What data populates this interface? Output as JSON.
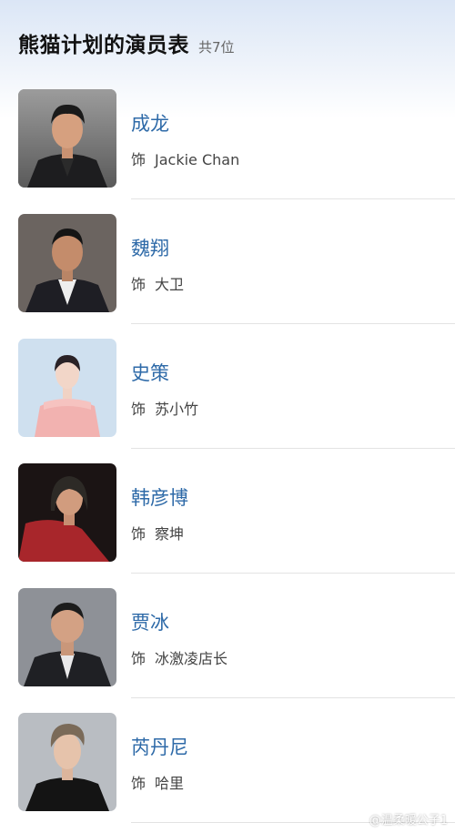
{
  "header": {
    "title": "熊猫计划的演员表",
    "count": "共7位"
  },
  "cast": [
    {
      "actor": "成龙",
      "role_prefix": "饰",
      "role": "Jackie Chan"
    },
    {
      "actor": "魏翔",
      "role_prefix": "饰",
      "role": "大卫"
    },
    {
      "actor": "史策",
      "role_prefix": "饰",
      "role": "苏小竹"
    },
    {
      "actor": "韩彦博",
      "role_prefix": "饰",
      "role": "察坤"
    },
    {
      "actor": "贾冰",
      "role_prefix": "饰",
      "role": "冰激凌店长"
    },
    {
      "actor": "芮丹尼",
      "role_prefix": "饰",
      "role": "哈里"
    }
  ],
  "watermark": "@温柔暖公子1",
  "colors": {
    "name_link": "#2e6aa8",
    "title": "#111111",
    "header_gradient_top": "#dbe6f6"
  }
}
